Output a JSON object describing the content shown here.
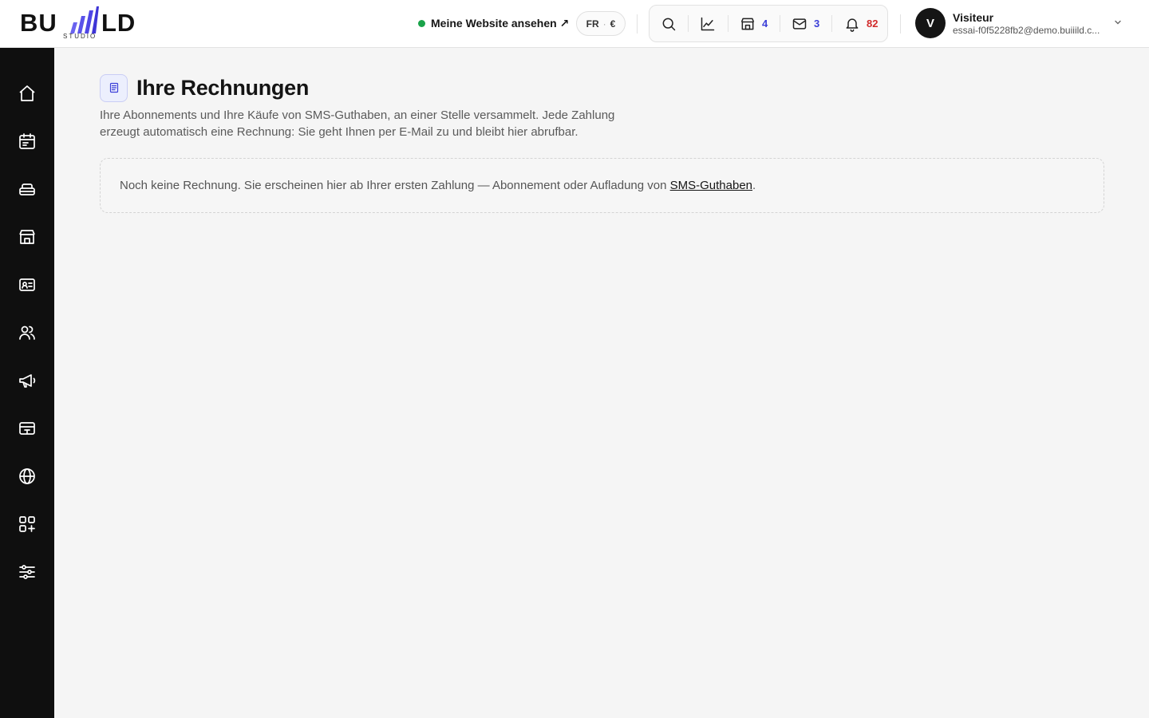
{
  "brand": {
    "word_a": "BU",
    "word_b": "LD",
    "sub": "STUDIO",
    "accent": "#4f46e5"
  },
  "header": {
    "site_link": {
      "label": "Meine Website ansehen ↗",
      "status_color": "#1aa34a"
    },
    "lang": {
      "language": "FR",
      "separator": "·",
      "currency": "€"
    },
    "toolbar": {
      "search_icon": "search-icon",
      "stats_icon": "chart-line-icon",
      "shop_count": "4",
      "mail_count": "3",
      "notifications_count": "82"
    },
    "user": {
      "initial": "V",
      "name": "Visiteur",
      "email": "essai-f0f5228fb2@demo.buiiild.c..."
    }
  },
  "sidebar": {
    "items": [
      {
        "icon": "home-icon"
      },
      {
        "icon": "calendar-icon"
      },
      {
        "icon": "services-icon"
      },
      {
        "icon": "storefront-icon"
      },
      {
        "icon": "contact-card-icon"
      },
      {
        "icon": "users-icon"
      },
      {
        "icon": "megaphone-icon"
      },
      {
        "icon": "payment-card-icon"
      },
      {
        "icon": "globe-icon"
      },
      {
        "icon": "apps-add-icon"
      },
      {
        "icon": "settings-sliders-icon"
      }
    ]
  },
  "main": {
    "title": "Ihre Rechnungen",
    "description": "Ihre Abonnements und Ihre Käufe von SMS-Guthaben, an einer Stelle versammelt. Jede Zahlung erzeugt automatisch eine Rechnung: Sie geht Ihnen per E-Mail zu und bleibt hier abrufbar.",
    "empty": {
      "text": "Noch keine Rechnung. Sie erscheinen hier ab Ihrer ersten Zahlung — Abonnement oder Aufladung von ",
      "link": "SMS-Guthaben",
      "suffix": "."
    }
  }
}
